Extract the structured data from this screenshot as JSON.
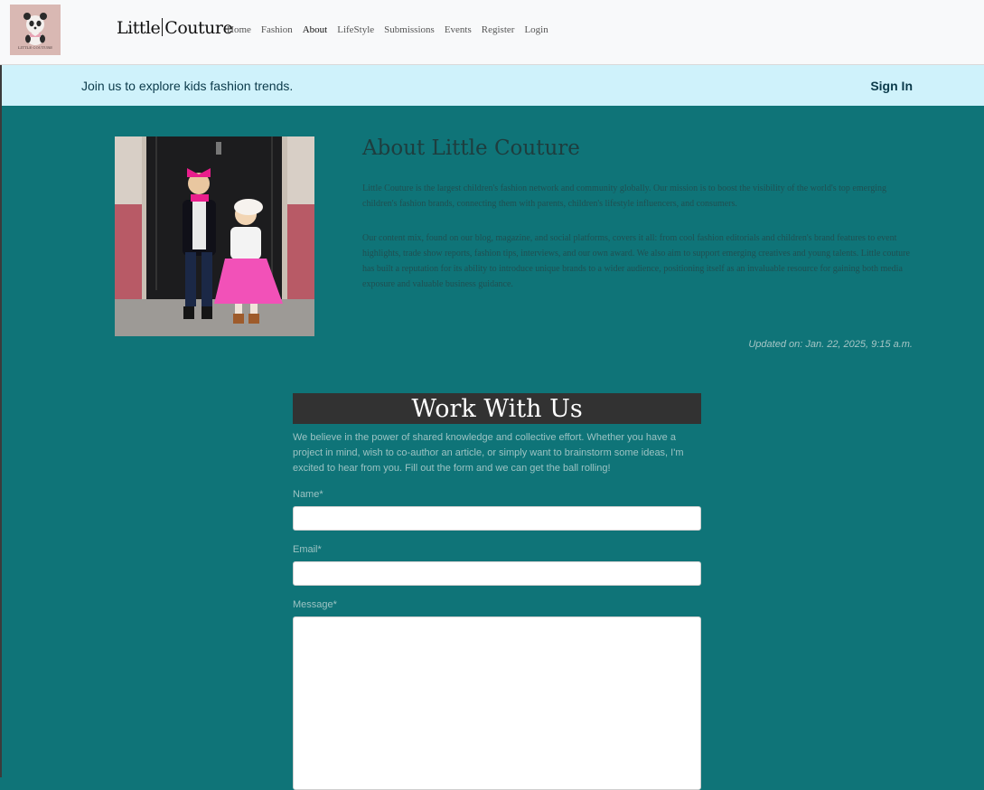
{
  "navbar": {
    "logo_text": "LITTLE COUTURE",
    "brand_left": "Little",
    "brand_right": "Couture",
    "links": [
      "Home",
      "Fashion",
      "About",
      "LifeStyle",
      "Submissions",
      "Events",
      "Register",
      "Login"
    ],
    "active_link": "About"
  },
  "banner": {
    "message": "Join us to explore kids fashion trends.",
    "signin_label": "Sign In"
  },
  "about": {
    "title": "About Little Couture",
    "paragraph1": "Little Couture  is the largest children's fashion network and community globally. Our mission is to boost the visibility of the world's top emerging children's fashion brands, connecting them with parents, children's lifestyle influencers, and consumers.",
    "paragraph2": "Our content mix, found on our blog, magazine, and social platforms, covers it all: from cool fashion editorials and children's brand features to event highlights, trade show reports, fashion tips, interviews, and our own award. We also aim to support emerging creatives and young talents. Little couture has built a reputation for its ability to introduce unique brands to a wider audience, positioning itself as an invaluable resource for gaining both media exposure and valuable business guidance.",
    "updated": "Updated on: Jan. 22, 2025, 9:15 a.m."
  },
  "work_with_us": {
    "title": "Work With Us",
    "intro": "We believe in the power of shared knowledge and collective effort. Whether you have a project in mind, wish to co-author an article, or simply want to brainstorm some ideas, I'm excited to hear from you. Fill out the form and we can get the ball rolling!",
    "name_label": "Name*",
    "email_label": "Email*",
    "message_label": "Message*",
    "name_value": "",
    "email_value": "",
    "message_value": ""
  },
  "colors": {
    "page_bg": "#0f7478",
    "banner_bg": "#cff2fb",
    "navbar_bg": "#f8f9fa",
    "heading_bg": "#323232"
  },
  "icons": {
    "logo": "panda-icon"
  }
}
